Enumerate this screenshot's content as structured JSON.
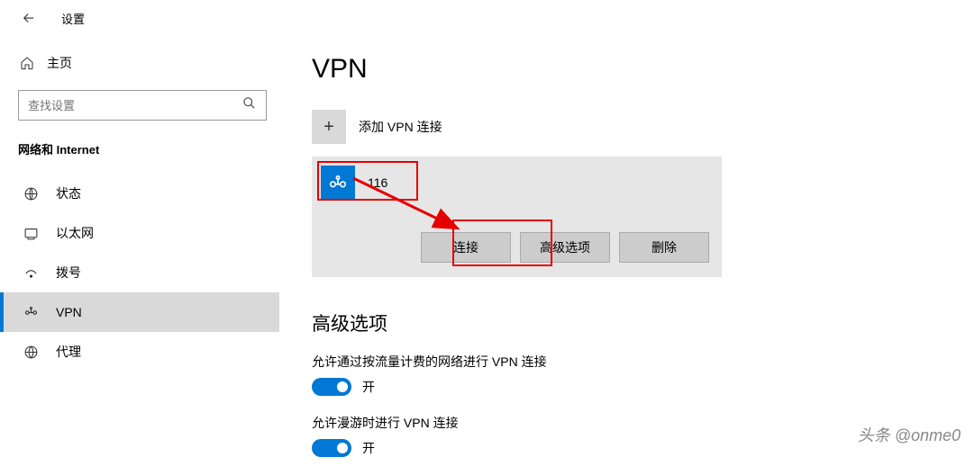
{
  "header": {
    "title": "设置"
  },
  "sidebar": {
    "home_label": "主页",
    "search_placeholder": "查找设置",
    "category": "网络和 Internet",
    "items": [
      {
        "label": "状态"
      },
      {
        "label": "以太网"
      },
      {
        "label": "拨号"
      },
      {
        "label": "VPN"
      },
      {
        "label": "代理"
      }
    ]
  },
  "main": {
    "page_title": "VPN",
    "add_label": "添加 VPN 连接",
    "vpn": {
      "name": "116"
    },
    "buttons": {
      "connect": "连接",
      "advanced": "高级选项",
      "delete": "删除"
    },
    "section_title": "高级选项",
    "toggle1_label": "允许通过按流量计费的网络进行 VPN 连接",
    "toggle2_label": "允许漫游时进行 VPN 连接",
    "toggle_on": "开"
  },
  "watermark": "头条 @onme0"
}
